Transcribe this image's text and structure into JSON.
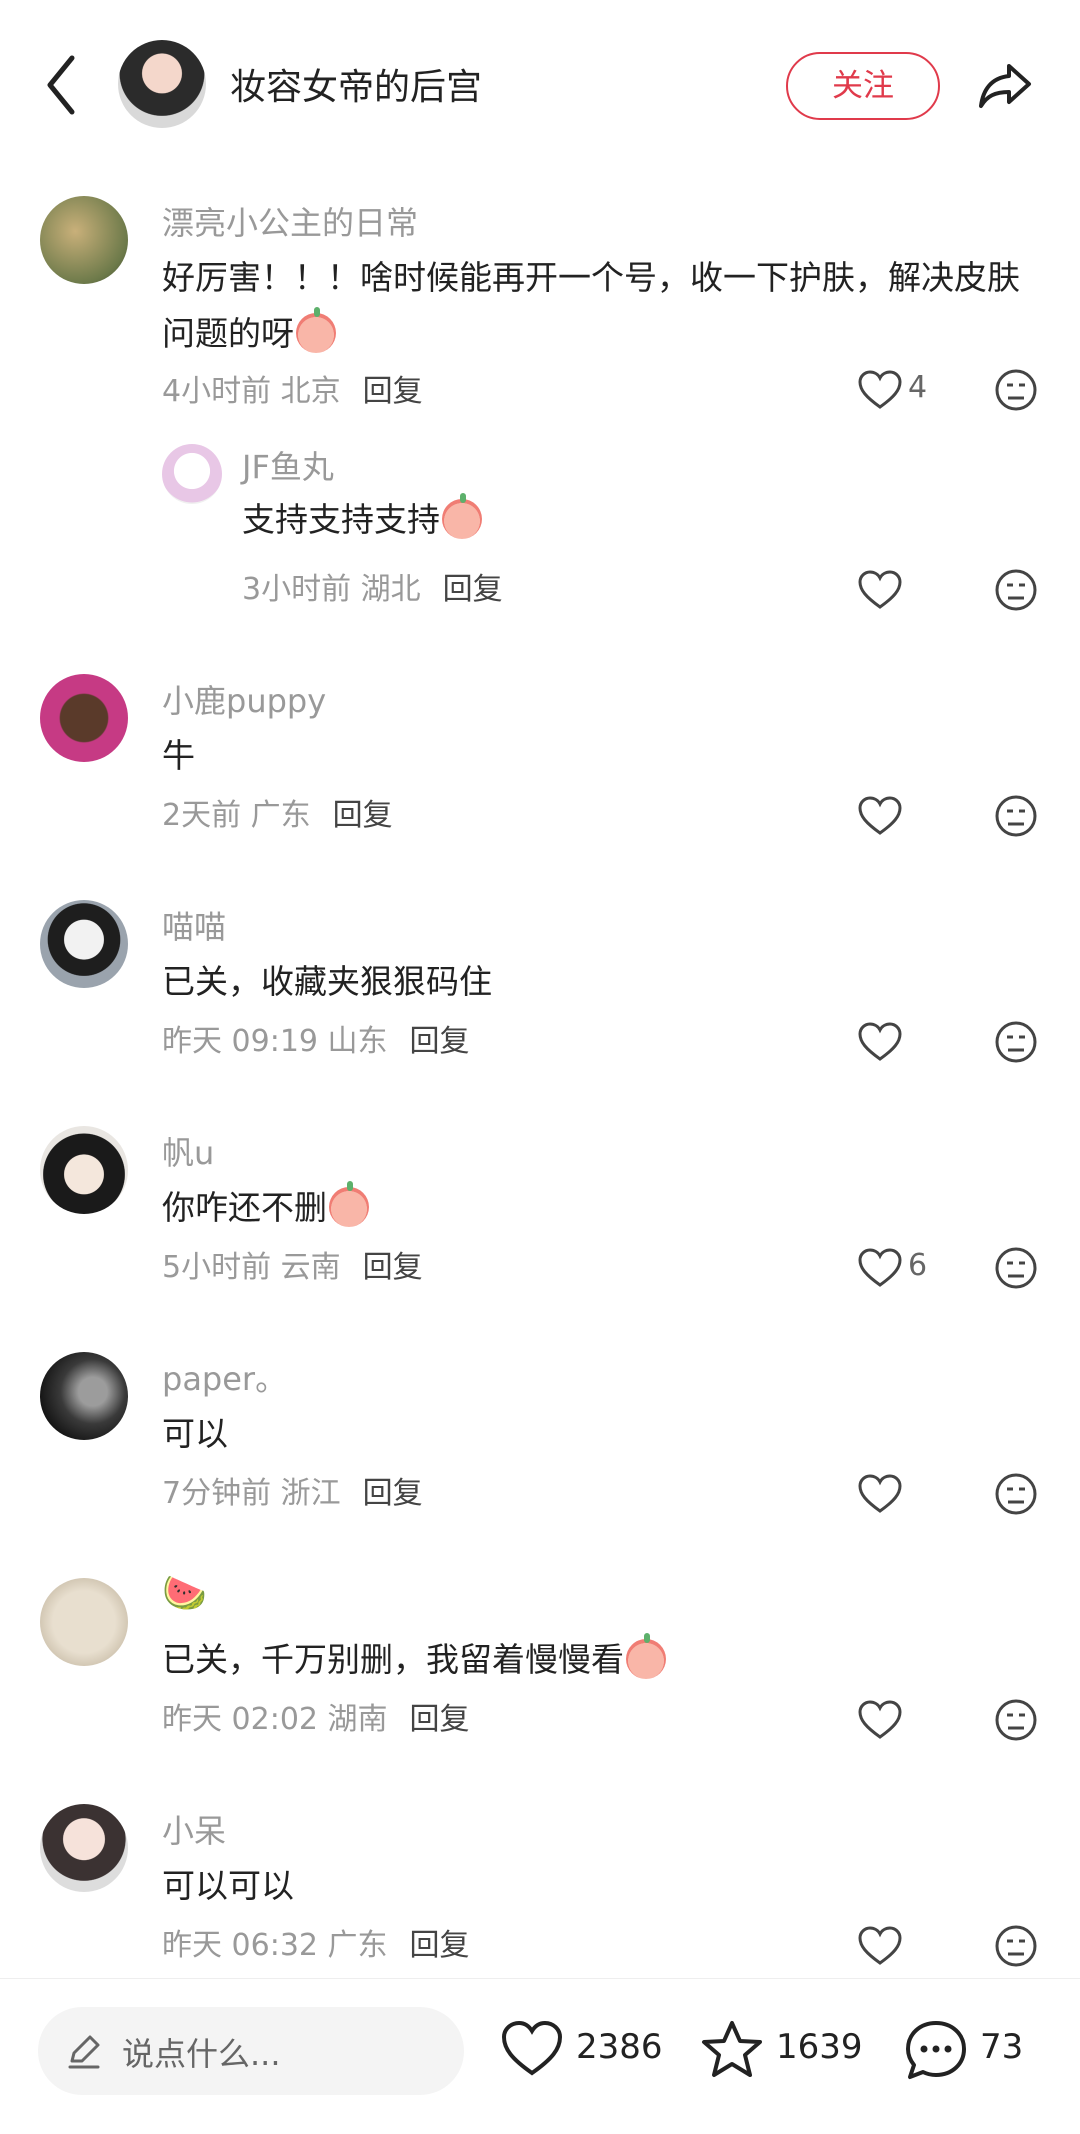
{
  "header": {
    "title": "妆容女帝的后宫",
    "follow_label": "关注"
  },
  "comments": [
    {
      "user": "漂亮小公主的日常",
      "text": "好厉害！！！啥时候能再开一个号，收一下护肤，解决皮肤问题的呀",
      "time": "4小时前 北京",
      "reply_label": "回复",
      "likes": "4"
    },
    {
      "user": "JF鱼丸",
      "text": "支持支持支持",
      "time": "3小时前 湖北",
      "reply_label": "回复",
      "likes": ""
    },
    {
      "user": "小鹿puppy",
      "text": "牛",
      "time": "2天前 广东",
      "reply_label": "回复",
      "likes": ""
    },
    {
      "user": "喵喵",
      "text": "已关，收藏夹狠狠码住",
      "time": "昨天 09:19 山东",
      "reply_label": "回复",
      "likes": ""
    },
    {
      "user": "帆u",
      "text": "你咋还不删",
      "time": "5小时前 云南",
      "reply_label": "回复",
      "likes": "6"
    },
    {
      "user": "paper。",
      "text": "可以",
      "time": "7分钟前 浙江",
      "reply_label": "回复",
      "likes": ""
    },
    {
      "user": "🍉",
      "text": "已关，千万别删，我留着慢慢看",
      "time": "昨天 02:02 湖南",
      "reply_label": "回复",
      "likes": ""
    },
    {
      "user": "小呆",
      "text": "可以可以",
      "time": "昨天 06:32 广东",
      "reply_label": "回复",
      "likes": ""
    }
  ],
  "bottom": {
    "input_placeholder": "说点什么...",
    "like_count": "2386",
    "fav_count": "1639",
    "comment_count": "73"
  },
  "colors": {
    "accent": "#e03a4b",
    "muted": "#999999"
  }
}
